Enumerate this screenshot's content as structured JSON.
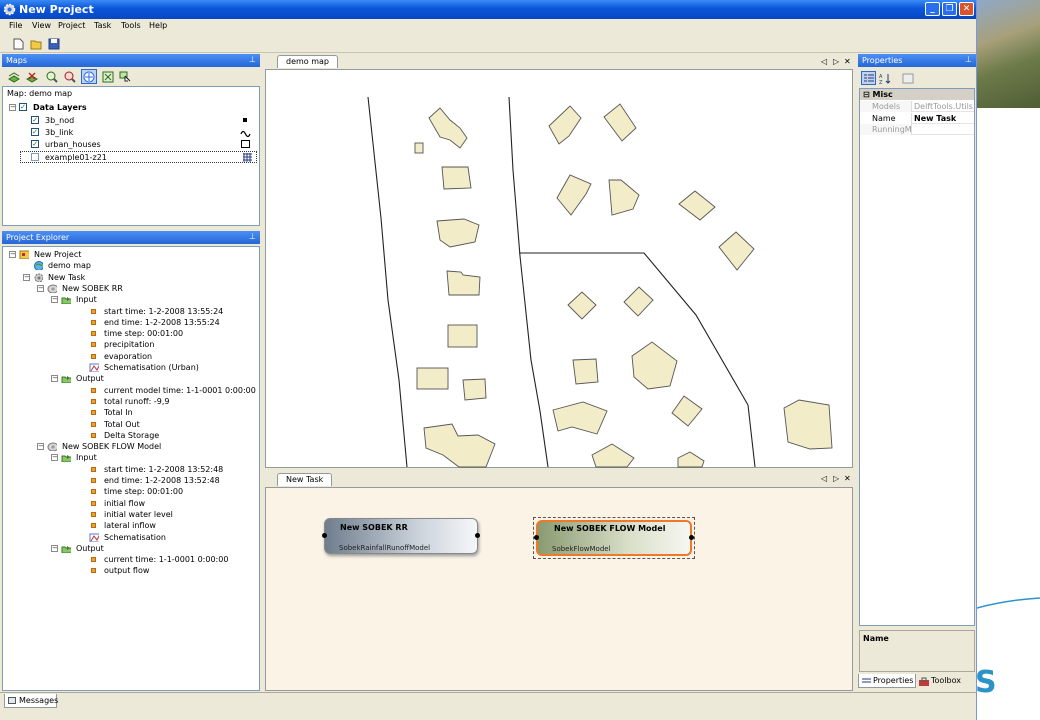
{
  "window": {
    "title": "New Project"
  },
  "menu": [
    "File",
    "View",
    "Project",
    "Task",
    "Tools",
    "Help"
  ],
  "toolbar": {
    "icons": [
      "new-file-icon",
      "open-folder-icon",
      "save-icon"
    ]
  },
  "maps_panel": {
    "title": "Maps",
    "map_label": "Map: demo map",
    "tools": [
      "add-layer-icon",
      "remove-layer-icon",
      "zoom-in-icon",
      "zoom-out-icon",
      "pan-icon",
      "zoom-extent-icon",
      "select-icon"
    ],
    "root": "Data Layers",
    "layers": [
      {
        "name": "3b_nod",
        "checked": true,
        "symbol": "point"
      },
      {
        "name": "3b_link",
        "checked": true,
        "symbol": "line"
      },
      {
        "name": "urban_houses",
        "checked": true,
        "symbol": "polygon"
      },
      {
        "name": "example01-z21",
        "checked": false,
        "symbol": "grid"
      }
    ]
  },
  "explorer": {
    "title": "Project Explorer",
    "items": [
      {
        "label": "New Project",
        "level": 0,
        "exp": "-",
        "icon": "project"
      },
      {
        "label": "demo map",
        "level": 1,
        "exp": "",
        "icon": "globe"
      },
      {
        "label": "New Task",
        "level": 1,
        "exp": "-",
        "icon": "gear"
      },
      {
        "label": "New SOBEK RR",
        "level": 2,
        "exp": "-",
        "icon": "model"
      },
      {
        "label": "Input",
        "level": 3,
        "exp": "-",
        "icon": "io"
      },
      {
        "label": "start time: 1-2-2008 13:55:24",
        "level": 4,
        "exp": "",
        "icon": "bullet"
      },
      {
        "label": "end time: 1-2-2008 13:55:24",
        "level": 4,
        "exp": "",
        "icon": "bullet"
      },
      {
        "label": "time step: 00:01:00",
        "level": 4,
        "exp": "",
        "icon": "bullet"
      },
      {
        "label": "precipitation",
        "level": 4,
        "exp": "",
        "icon": "bullet"
      },
      {
        "label": "evaporation",
        "level": 4,
        "exp": "",
        "icon": "bullet"
      },
      {
        "label": "Schematisation (Urban)",
        "level": 4,
        "exp": "",
        "icon": "schema"
      },
      {
        "label": "Output",
        "level": 3,
        "exp": "-",
        "icon": "io"
      },
      {
        "label": "current model time: 1-1-0001 0:00:00",
        "level": 4,
        "exp": "",
        "icon": "bullet"
      },
      {
        "label": "total runoff: -9,9",
        "level": 4,
        "exp": "",
        "icon": "bullet"
      },
      {
        "label": "Total In",
        "level": 4,
        "exp": "",
        "icon": "bullet"
      },
      {
        "label": "Total Out",
        "level": 4,
        "exp": "",
        "icon": "bullet"
      },
      {
        "label": "Delta Storage",
        "level": 4,
        "exp": "",
        "icon": "bullet"
      },
      {
        "label": "New SOBEK FLOW Model",
        "level": 2,
        "exp": "-",
        "icon": "model"
      },
      {
        "label": "Input",
        "level": 3,
        "exp": "-",
        "icon": "io"
      },
      {
        "label": "start time: 1-2-2008 13:52:48",
        "level": 4,
        "exp": "",
        "icon": "bullet"
      },
      {
        "label": "end time: 1-2-2008 13:52:48",
        "level": 4,
        "exp": "",
        "icon": "bullet"
      },
      {
        "label": "time step: 00:01:00",
        "level": 4,
        "exp": "",
        "icon": "bullet"
      },
      {
        "label": "initial flow",
        "level": 4,
        "exp": "",
        "icon": "bullet"
      },
      {
        "label": "initial water level",
        "level": 4,
        "exp": "",
        "icon": "bullet"
      },
      {
        "label": "lateral inflow",
        "level": 4,
        "exp": "",
        "icon": "bullet"
      },
      {
        "label": "Schematisation",
        "level": 4,
        "exp": "",
        "icon": "schema"
      },
      {
        "label": "Output",
        "level": 3,
        "exp": "-",
        "icon": "io"
      },
      {
        "label": "current time: 1-1-0001 0:00:00",
        "level": 4,
        "exp": "",
        "icon": "bullet"
      },
      {
        "label": "output flow",
        "level": 4,
        "exp": "",
        "icon": "bullet"
      }
    ]
  },
  "map_doc": {
    "tab": "demo map"
  },
  "task_doc": {
    "tab": "New Task",
    "node1": {
      "title": "New SOBEK RR",
      "sub": "SobekRainfallRunoffModel"
    },
    "node2": {
      "title": "New SOBEK FLOW Model",
      "sub": "SobekFlowModel"
    }
  },
  "doc_nav": {
    "left": "◁",
    "right": "▷",
    "close": "✕"
  },
  "properties": {
    "title": "Properties",
    "category": "Misc",
    "rows": [
      {
        "key": "Models",
        "value": "DelftTools.Utils.C",
        "bold": false,
        "greyed": true
      },
      {
        "key": "Name",
        "value": "New Task",
        "bold": true,
        "greyed": false
      },
      {
        "key": "RunningMo",
        "value": "",
        "bold": false,
        "greyed": true
      }
    ],
    "desc_label": "Name",
    "tabs": [
      "Properties",
      "Toolbox"
    ]
  },
  "status_tab": "Messages",
  "colors": {
    "titlebar": "#0a56d8",
    "panel_header": "#2f72e0",
    "accent_orange": "#f07828"
  }
}
